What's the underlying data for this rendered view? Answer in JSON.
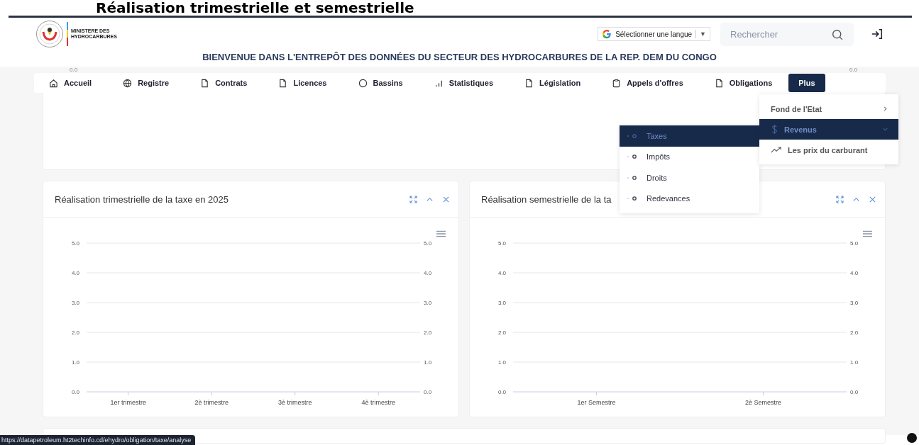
{
  "page_heading": "Réalisation trimestrielle et semestrielle",
  "header": {
    "ministry_lines": [
      "MINISTERE DES",
      "HYDROCARBURES"
    ],
    "language_select": {
      "label": "Sélectionner une langue",
      "arrow": "▼"
    },
    "search": {
      "placeholder": "Rechercher"
    },
    "welcome": "BIENVENUE DANS L'ENTREPÔT DES DONNÉES DU SECTEUR DES HYDROCARBURES DE LA REP. DEM DU CONGO"
  },
  "top_card": {
    "left_tick": "0.0",
    "right_tick": "0.0"
  },
  "nav": [
    {
      "label": "Accueil",
      "selected": false
    },
    {
      "label": "Registre",
      "selected": false
    },
    {
      "label": "Contrats",
      "selected": false
    },
    {
      "label": "Licences",
      "selected": false
    },
    {
      "label": "Bassins",
      "selected": false
    },
    {
      "label": "Statistiques",
      "selected": false
    },
    {
      "label": "Législation",
      "selected": false
    },
    {
      "label": "Appels d'offres",
      "selected": false
    },
    {
      "label": "Obligations",
      "selected": false
    },
    {
      "label": "Plus",
      "selected": true
    }
  ],
  "plus_menu": [
    {
      "label": "Fond de l'Etat",
      "selected": false,
      "expanded": false
    },
    {
      "label": "Revenus",
      "selected": true,
      "expanded": true
    },
    {
      "label": "Les prix du carburant",
      "selected": false
    }
  ],
  "submenu": [
    {
      "label": "Taxes",
      "selected": true
    },
    {
      "label": "Impôts",
      "selected": false
    },
    {
      "label": "Droits",
      "selected": false
    },
    {
      "label": "Redevances",
      "selected": false
    }
  ],
  "charts": [
    {
      "title": "Réalisation trimestrielle de la taxe en 2025",
      "chart_data": {
        "type": "line",
        "categories": [
          "1er trimestre",
          "2è trimestre",
          "3è trimestre",
          "4è trimestre"
        ],
        "grid": true,
        "ylim": [
          0,
          5
        ],
        "yticks": [
          {
            "value": 0,
            "label": "0.0"
          },
          {
            "value": 1,
            "label": "1.0"
          },
          {
            "value": 2,
            "label": "2.0"
          },
          {
            "value": 3,
            "label": "3.0"
          },
          {
            "value": 4,
            "label": "4.0"
          },
          {
            "value": 5,
            "label": "5.0"
          }
        ]
      }
    },
    {
      "title": "Réalisation semestrielle de la ta",
      "chart_data": {
        "type": "line",
        "categories": [
          "1er Semestre",
          "2è Semestre"
        ],
        "grid": true,
        "ylim": [
          0,
          5
        ],
        "yticks": [
          {
            "value": 0,
            "label": "0.0"
          },
          {
            "value": 1,
            "label": "1.0"
          },
          {
            "value": 2,
            "label": "2.0"
          },
          {
            "value": 3,
            "label": "3.0"
          },
          {
            "value": 4,
            "label": "4.0"
          },
          {
            "value": 5,
            "label": "5.0"
          }
        ]
      }
    }
  ],
  "status_bar": {
    "url": "https://datapetroleum.ht2techinfo.cd/ehydro/obligation/taxe/analyse"
  }
}
